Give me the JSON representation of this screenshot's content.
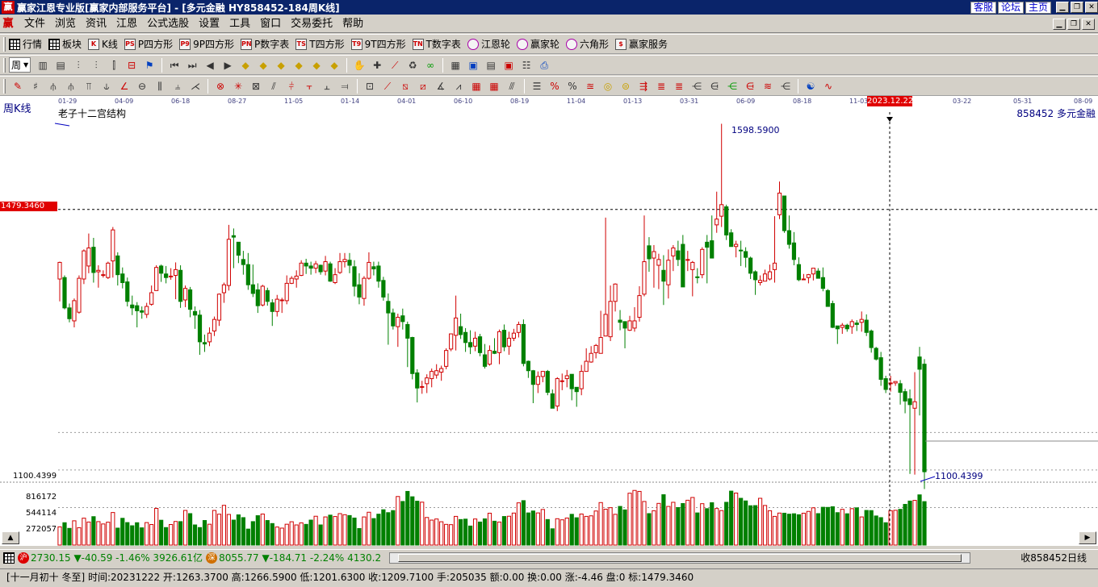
{
  "window": {
    "logo": "赢",
    "title": "赢家江恩专业版[赢家内部服务平台] - [多元金融   HY858452-184周K线]",
    "links": [
      "客服",
      "论坛",
      "主页"
    ]
  },
  "menu": {
    "logo": "赢",
    "items": [
      "文件",
      "浏览",
      "资讯",
      "江恩",
      "公式选股",
      "设置",
      "工具",
      "窗口",
      "交易委托",
      "帮助"
    ]
  },
  "toolbar1": [
    {
      "label": "行情",
      "icon": "grid"
    },
    {
      "label": "板块",
      "icon": "grid"
    },
    {
      "label": "K线",
      "icon": "K"
    },
    {
      "label": "P四方形",
      "icon": "PS"
    },
    {
      "label": "9P四方形",
      "icon": "P9"
    },
    {
      "label": "P数字表",
      "icon": "PN"
    },
    {
      "label": "T四方形",
      "icon": "TS"
    },
    {
      "label": "9T四方形",
      "icon": "T9"
    },
    {
      "label": "T数字表",
      "icon": "TN"
    },
    {
      "label": "江恩轮",
      "icon": "circ"
    },
    {
      "label": "赢家轮",
      "icon": "circ"
    },
    {
      "label": "六角形",
      "icon": "circ"
    },
    {
      "label": "赢家服务",
      "icon": "$"
    }
  ],
  "toolbar2": {
    "period_label": "周"
  },
  "chart": {
    "period": "周K线",
    "indicator": "老子十二宫结构",
    "code_name": "858452 多元金融",
    "ref_price": "1479.3460",
    "high_label": "1598.5900",
    "low_label": "1100.4399",
    "low_axis": "1100.4399",
    "vol_axis": [
      "816172",
      "544114",
      "272057"
    ],
    "date_badge": "2023.12.22",
    "x_ticks": [
      "01-29",
      "04-09",
      "06-18",
      "08-27",
      "11-05",
      "01-14",
      "04-01",
      "06-10",
      "08-19",
      "11-04",
      "01-13",
      "03-31",
      "06-09",
      "08-18",
      "11-03",
      "03-22",
      "05-31",
      "08-09"
    ]
  },
  "chart_data": {
    "type": "candlestick",
    "title": "",
    "ylim": [
      1100.4399,
      1598.59
    ],
    "ref_line": 1479.346,
    "high": 1598.59,
    "low": 1100.4399,
    "vol_ticks": [
      816172,
      544114,
      272057
    ],
    "candles_ohlc": [
      [
        1383,
        1406,
        1352,
        1407
      ],
      [
        1385,
        1343,
        1341,
        1388
      ],
      [
        1343,
        1328,
        1323,
        1349
      ],
      [
        1325,
        1353,
        1316,
        1356
      ],
      [
        1337,
        1384,
        1335,
        1388
      ],
      [
        1383,
        1422,
        1376,
        1424
      ],
      [
        1401,
        1426,
        1391,
        1446
      ],
      [
        1427,
        1392,
        1378,
        1440
      ],
      [
        1393,
        1395,
        1371,
        1402
      ],
      [
        1389,
        1389,
        1385,
        1395
      ],
      [
        1385,
        1405,
        1383,
        1407
      ],
      [
        1408,
        1451,
        1385,
        1455
      ],
      [
        1415,
        1389,
        1374,
        1420
      ],
      [
        1390,
        1378,
        1370,
        1399
      ],
      [
        1379,
        1352,
        1345,
        1385
      ],
      [
        1347,
        1343,
        1333,
        1360
      ],
      [
        1346,
        1339,
        1316,
        1351
      ],
      [
        1339,
        1337,
        1328,
        1345
      ],
      [
        1334,
        1345,
        1329,
        1350
      ],
      [
        1348,
        1364,
        1346,
        1374
      ],
      [
        1367,
        1399,
        1367,
        1402
      ],
      [
        1401,
        1391,
        1379,
        1403
      ],
      [
        1390,
        1385,
        1377,
        1401
      ],
      [
        1386,
        1387,
        1382,
        1398
      ],
      [
        1388,
        1396,
        1355,
        1406
      ],
      [
        1395,
        1352,
        1343,
        1402
      ],
      [
        1354,
        1370,
        1344,
        1374
      ],
      [
        1368,
        1341,
        1330,
        1372
      ],
      [
        1338,
        1333,
        1314,
        1345
      ],
      [
        1333,
        1296,
        1278,
        1340
      ],
      [
        1295,
        1293,
        1282,
        1306
      ],
      [
        1296,
        1308,
        1290,
        1316
      ],
      [
        1311,
        1327,
        1304,
        1331
      ],
      [
        1326,
        1362,
        1318,
        1363
      ],
      [
        1364,
        1375,
        1350,
        1378
      ],
      [
        1374,
        1438,
        1367,
        1458
      ],
      [
        1443,
        1441,
        1398,
        1453
      ],
      [
        1434,
        1416,
        1405,
        1434
      ],
      [
        1410,
        1403,
        1389,
        1422
      ],
      [
        1403,
        1375,
        1368,
        1419
      ],
      [
        1375,
        1363,
        1358,
        1403
      ],
      [
        1368,
        1346,
        1336,
        1377
      ],
      [
        1347,
        1373,
        1345,
        1375
      ],
      [
        1367,
        1352,
        1346,
        1371
      ],
      [
        1350,
        1338,
        1318,
        1355
      ],
      [
        1338,
        1355,
        1331,
        1361
      ],
      [
        1353,
        1354,
        1336,
        1357
      ],
      [
        1353,
        1377,
        1348,
        1388
      ],
      [
        1377,
        1384,
        1376,
        1387
      ],
      [
        1383,
        1387,
        1371,
        1395
      ],
      [
        1388,
        1405,
        1387,
        1409
      ],
      [
        1405,
        1401,
        1390,
        1411
      ],
      [
        1401,
        1398,
        1389,
        1407
      ],
      [
        1398,
        1404,
        1391,
        1408
      ],
      [
        1402,
        1393,
        1389,
        1403
      ],
      [
        1394,
        1407,
        1388,
        1415
      ],
      [
        1404,
        1380,
        1379,
        1407
      ],
      [
        1378,
        1389,
        1376,
        1398
      ],
      [
        1392,
        1407,
        1390,
        1419
      ],
      [
        1407,
        1410,
        1399,
        1419
      ],
      [
        1409,
        1402,
        1391,
        1419
      ],
      [
        1400,
        1373,
        1359,
        1409
      ],
      [
        1375,
        1358,
        1348,
        1391
      ],
      [
        1356,
        1384,
        1346,
        1387
      ],
      [
        1384,
        1406,
        1382,
        1420
      ],
      [
        1400,
        1397,
        1388,
        1407
      ],
      [
        1401,
        1380,
        1371,
        1407
      ],
      [
        1381,
        1358,
        1353,
        1386
      ],
      [
        1352,
        1336,
        1292,
        1363
      ],
      [
        1336,
        1318,
        1313,
        1342
      ],
      [
        1317,
        1330,
        1289,
        1335
      ],
      [
        1332,
        1324,
        1313,
        1342
      ],
      [
        1320,
        1301,
        1261,
        1324
      ],
      [
        1302,
        1252,
        1244,
        1303
      ],
      [
        1253,
        1232,
        1212,
        1258
      ],
      [
        1234,
        1234,
        1224,
        1242
      ],
      [
        1238,
        1246,
        1225,
        1251
      ],
      [
        1245,
        1255,
        1233,
        1259
      ],
      [
        1250,
        1256,
        1245,
        1265
      ],
      [
        1254,
        1259,
        1242,
        1263
      ],
      [
        1262,
        1284,
        1258,
        1287
      ],
      [
        1286,
        1307,
        1283,
        1307
      ],
      [
        1305,
        1329,
        1284,
        1360
      ],
      [
        1317,
        1306,
        1300,
        1335
      ],
      [
        1309,
        1295,
        1282,
        1315
      ],
      [
        1295,
        1289,
        1279,
        1312
      ],
      [
        1290,
        1301,
        1283,
        1310
      ],
      [
        1303,
        1281,
        1276,
        1307
      ],
      [
        1278,
        1262,
        1259,
        1293
      ],
      [
        1265,
        1284,
        1263,
        1291
      ],
      [
        1283,
        1280,
        1279,
        1301
      ],
      [
        1281,
        1310,
        1265,
        1313
      ],
      [
        1312,
        1289,
        1283,
        1320
      ],
      [
        1290,
        1301,
        1278,
        1310
      ],
      [
        1301,
        1308,
        1297,
        1314
      ],
      [
        1309,
        1320,
        1302,
        1324
      ],
      [
        1320,
        1266,
        1262,
        1327
      ],
      [
        1269,
        1256,
        1246,
        1270
      ],
      [
        1256,
        1237,
        1211,
        1257
      ],
      [
        1237,
        1248,
        1225,
        1255
      ],
      [
        1248,
        1255,
        1240,
        1255
      ],
      [
        1255,
        1226,
        1222,
        1257
      ],
      [
        1224,
        1204,
        1204,
        1230
      ],
      [
        1207,
        1245,
        1200,
        1247
      ],
      [
        1241,
        1242,
        1229,
        1252
      ],
      [
        1245,
        1249,
        1233,
        1257
      ],
      [
        1251,
        1231,
        1215,
        1250
      ],
      [
        1233,
        1227,
        1206,
        1233
      ],
      [
        1231,
        1255,
        1222,
        1264
      ],
      [
        1255,
        1269,
        1256,
        1287
      ],
      [
        1268,
        1280,
        1267,
        1290
      ],
      [
        1281,
        1291,
        1273,
        1293
      ],
      [
        1280,
        1302,
        1282,
        1339
      ],
      [
        1304,
        1334,
        1311,
        1468
      ],
      [
        1303,
        1352,
        1297,
        1374
      ],
      [
        1352,
        1376,
        1338,
        1377
      ],
      [
        1326,
        1323,
        1312,
        1340
      ],
      [
        1324,
        1315,
        1287,
        1322
      ],
      [
        1312,
        1325,
        1311,
        1332
      ],
      [
        1315,
        1325,
        1310,
        1344
      ],
      [
        1330,
        1360,
        1324,
        1373
      ],
      [
        1362,
        1407,
        1359,
        1471
      ],
      [
        1429,
        1411,
        1393,
        1441
      ],
      [
        1412,
        1421,
        1371,
        1430
      ],
      [
        1402,
        1410,
        1369,
        1418
      ],
      [
        1395,
        1380,
        1347,
        1416
      ],
      [
        1375,
        1409,
        1356,
        1424
      ],
      [
        1415,
        1426,
        1394,
        1430
      ],
      [
        1422,
        1410,
        1401,
        1436
      ],
      [
        1431,
        1372,
        1391,
        1444
      ],
      [
        1409,
        1410,
        1394,
        1422
      ],
      [
        1396,
        1406,
        1359,
        1408
      ],
      [
        1386,
        1385,
        1377,
        1398
      ],
      [
        1389,
        1424,
        1384,
        1427
      ],
      [
        1434,
        1427,
        1377,
        1444
      ],
      [
        1436,
        1412,
        1419,
        1471
      ],
      [
        1458,
        1466,
        1447,
        1504
      ],
      [
        1470,
        1486,
        1455,
        1598
      ],
      [
        1483,
        1444,
        1437,
        1486
      ],
      [
        1447,
        1428,
        1435,
        1452
      ],
      [
        1428,
        1431,
        1413,
        1436
      ],
      [
        1423,
        1422,
        1401,
        1436
      ],
      [
        1421,
        1413,
        1399,
        1427
      ],
      [
        1412,
        1391,
        1383,
        1414
      ],
      [
        1393,
        1382,
        1361,
        1395
      ],
      [
        1378,
        1381,
        1374,
        1388
      ],
      [
        1380,
        1390,
        1383,
        1396
      ],
      [
        1383,
        1393,
        1381,
        1403
      ],
      [
        1396,
        1405,
        1378,
        1470
      ],
      [
        1472,
        1502,
        1466,
        1518
      ],
      [
        1498,
        1450,
        1447,
        1497
      ],
      [
        1450,
        1431,
        1425,
        1471
      ],
      [
        1433,
        1410,
        1402,
        1448
      ],
      [
        1403,
        1382,
        1380,
        1413
      ],
      [
        1383,
        1383,
        1383,
        1390
      ],
      [
        1385,
        1389,
        1377,
        1390
      ],
      [
        1390,
        1398,
        1381,
        1398
      ],
      [
        1394,
        1384,
        1385,
        1398
      ],
      [
        1385,
        1370,
        1366,
        1399
      ],
      [
        1367,
        1345,
        1345,
        1369
      ],
      [
        1349,
        1316,
        1315,
        1353
      ],
      [
        1318,
        1314,
        1293,
        1318
      ],
      [
        1316,
        1319,
        1307,
        1322
      ],
      [
        1319,
        1314,
        1310,
        1321
      ],
      [
        1317,
        1324,
        1307,
        1327
      ],
      [
        1322,
        1320,
        1311,
        1326
      ],
      [
        1323,
        1327,
        1310,
        1338
      ],
      [
        1326,
        1309,
        1304,
        1334
      ],
      [
        1311,
        1288,
        1281,
        1313
      ],
      [
        1287,
        1272,
        1270,
        1289
      ],
      [
        1274,
        1244,
        1235,
        1282
      ],
      [
        1245,
        1230,
        1225,
        1249
      ],
      [
        1238,
        1239,
        1227,
        1249
      ],
      [
        1239,
        1241,
        1235,
        1241
      ],
      [
        1238,
        1226,
        1209,
        1243
      ],
      [
        1227,
        1214,
        1197,
        1231
      ],
      [
        1217,
        1209,
        1113,
        1230
      ],
      [
        1204,
        1213,
        1112,
        1254
      ],
      [
        1275,
        1258,
        1194,
        1289
      ],
      [
        1265,
        1116,
        1092,
        1272
      ]
    ],
    "volumes": [
      132000,
      162000,
      121000,
      176000,
      126000,
      195000,
      167000,
      206000,
      170000,
      153000,
      166000,
      236000,
      123000,
      194000,
      163000,
      140000,
      162000,
      125000,
      163000,
      149000,
      266000,
      180000,
      127000,
      149000,
      171000,
      170000,
      251000,
      228000,
      146000,
      127000,
      178000,
      151000,
      251000,
      224000,
      288000,
      222000,
      181000,
      219000,
      199000,
      116000,
      170000,
      213000,
      225000,
      178000,
      156000,
      131000,
      123000,
      151000,
      169000,
      146000,
      161000,
      150000,
      181000,
      209000,
      146000,
      204000,
      217000,
      207000,
      228000,
      220000,
      214000,
      196000,
      120000,
      204000,
      238000,
      192000,
      224000,
      256000,
      235000,
      250000,
      352000,
      316000,
      389000,
      350000,
      318000,
      311000,
      200000,
      181000,
      189000,
      169000,
      150000,
      148000,
      208000,
      185000,
      188000,
      138000,
      189000,
      167000,
      190000,
      231000,
      173000,
      167000,
      207000,
      209000,
      232000,
      306000,
      322000,
      233000,
      247000,
      233000,
      258000,
      185000,
      118000,
      191000,
      183000,
      196000,
      223000,
      198000,
      225000,
      208000,
      212000,
      247000,
      308000,
      260000,
      271000,
      223000,
      280000,
      255000,
      376000,
      396000,
      389000,
      316000,
      228000,
      249000,
      302000,
      365000,
      280000,
      310000,
      272000,
      301000,
      325000,
      345000,
      233000,
      300000,
      264000,
      307000,
      265000,
      250000,
      310000,
      391000,
      377000,
      339000,
      320000,
      285000,
      286000,
      339000,
      287000,
      249000,
      208000,
      232000,
      231000,
      224000,
      227000,
      220000,
      231000,
      244000,
      270000,
      228000,
      274000,
      273000,
      278000,
      235000,
      259000,
      227000,
      264000,
      270000,
      204000,
      251000,
      250000,
      211000,
      199000,
      162000,
      249000,
      252000,
      259000,
      295000,
      319000,
      324000,
      364000,
      315000,
      319000,
      307000,
      366000
    ]
  },
  "status": {
    "sh_badge": "沪",
    "sh": "2730.15 ▼-40.59 -1.46% 3926.61亿",
    "sz_badge": "深",
    "sz": "8055.77 ▼-184.71 -2.24% 4130.2",
    "right": "收858452日线"
  },
  "info": "[十一月初十 冬至] 时间:20231222 开:1263.3700 高:1266.5900 低:1201.6300 收:1209.7100 手:205035 额:0.00 换:0.00 涨:-4.46 盘:0 标:1479.3460"
}
